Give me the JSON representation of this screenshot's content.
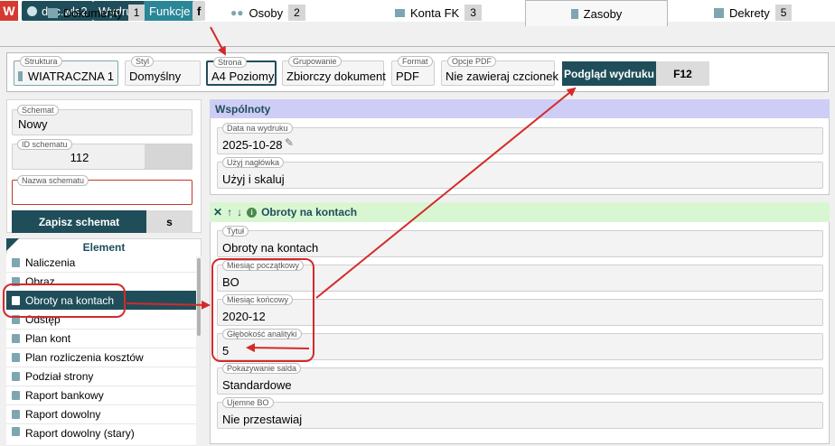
{
  "topbar": {
    "logo": "W",
    "user": "doc.wls2",
    "wydruki": "Wydruki",
    "funkcje": "Funkcje",
    "f": "f"
  },
  "tabs": [
    {
      "label": "Dokumenty",
      "num": "1",
      "icon": "document-icon"
    },
    {
      "label": "Osoby",
      "num": "2",
      "icon": "people-icon"
    },
    {
      "label": "Konta FK",
      "num": "3",
      "icon": "folder-icon"
    },
    {
      "label": "Zasoby",
      "num": "",
      "icon": "building-icon"
    },
    {
      "label": "Dekrety",
      "num": "5",
      "icon": "document-icon"
    }
  ],
  "toolbar": {
    "struktura": {
      "label": "Struktura",
      "value": "WIATRACZNA 1"
    },
    "styl": {
      "label": "Styl",
      "value": "Domyślny"
    },
    "strona": {
      "label": "Strona",
      "value": "A4 Poziomy"
    },
    "grupowanie": {
      "label": "Grupowanie",
      "value": "Zbiorczy dokument"
    },
    "format": {
      "label": "Format",
      "value": "PDF"
    },
    "opcje_pdf": {
      "label": "Opcje PDF",
      "value": "Nie zawieraj czcionek"
    },
    "preview": "Podgląd wydruku",
    "shortcut": "F12"
  },
  "left": {
    "schemat": {
      "label": "Schemat",
      "value": "Nowy"
    },
    "id_schematu": {
      "label": "ID schematu",
      "value": "112"
    },
    "nazwa_schematu": {
      "label": "Nazwa schematu",
      "value": ""
    },
    "save": "Zapisz schemat",
    "s": "s",
    "element_header": "Element",
    "elements": [
      "Naliczenia",
      "Obraz",
      "Obroty na kontach",
      "Odstęp",
      "Plan kont",
      "Plan rozliczenia kosztów",
      "Podział strony",
      "Raport bankowy",
      "Raport dowolny",
      "Raport dowolny (stary)"
    ]
  },
  "wspolnoty": {
    "title": "Wspólnoty",
    "data_label": "Data na wydruku",
    "data_value": "2025-10-28",
    "naglowek_label": "Użyj nagłówka",
    "naglowek_value": "Użyj i skaluj"
  },
  "obroty": {
    "title": "Obroty na kontach",
    "tytul_label": "Tytuł",
    "tytul_value": "Obroty na kontach",
    "mies_pocz_label": "Miesiąc początkowy",
    "mies_pocz_value": "BO",
    "mies_konc_label": "Miesiąc końcowy",
    "mies_konc_value": "2020-12",
    "glebokosc_label": "Głębokość analityki",
    "glebokosc_value": "5",
    "saldo_label": "Pokazywanie salda",
    "saldo_value": "Standardowe",
    "ujemne_label": "Ujemne BO",
    "ujemne_value": "Nie przestawiaj"
  },
  "colors": {
    "accent": "#1f4e5a",
    "annotation": "#d42a2a",
    "wspolnoty_header": "#cdcdf6",
    "obroty_header": "#d9f6d3"
  }
}
